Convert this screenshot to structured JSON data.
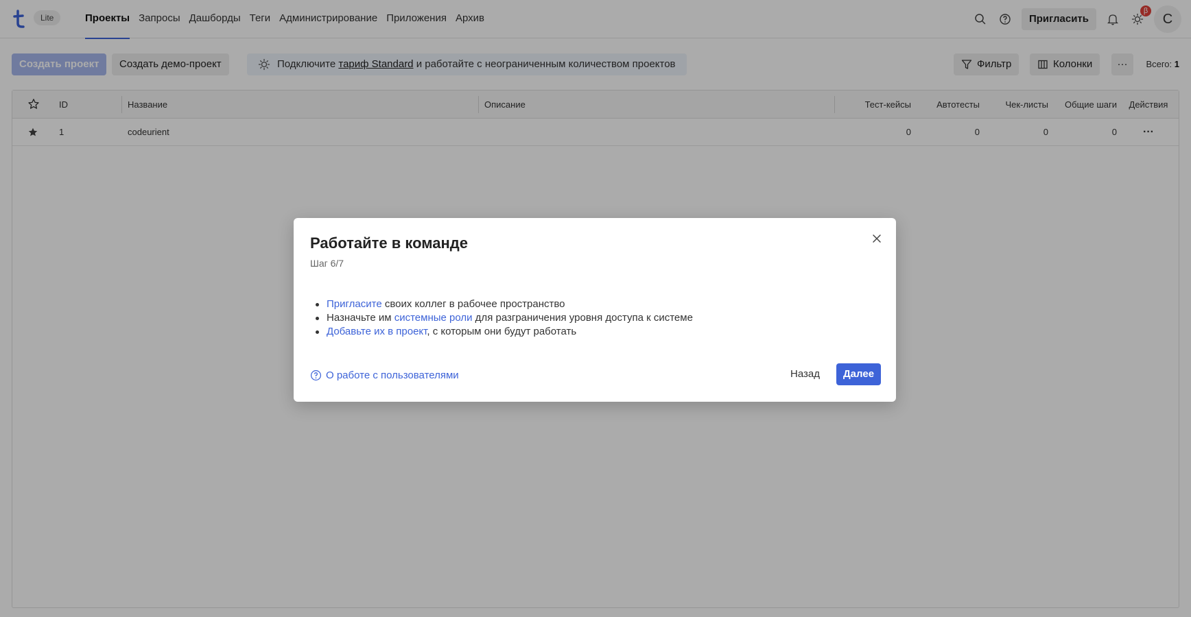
{
  "header": {
    "logo_icon": "tesys-logo",
    "plan_badge": "Lite",
    "nav": [
      {
        "label": "Проекты",
        "active": true
      },
      {
        "label": "Запросы"
      },
      {
        "label": "Дашборды"
      },
      {
        "label": "Теги"
      },
      {
        "label": "Администрирование"
      },
      {
        "label": "Приложения"
      },
      {
        "label": "Архив"
      }
    ],
    "invite_label": "Пригласить",
    "beta_badge": "β",
    "avatar_letter": "C",
    "accent_color": "#3d63d8"
  },
  "toolbar": {
    "create_label": "Создать проект",
    "demo_label": "Создать демо-проект",
    "promo_prefix": "Подключите",
    "promo_link": "тариф Standard",
    "promo_suffix": "и работайте с неограниченным количеством проектов",
    "filter_label": "Фильтр",
    "columns_label": "Колонки",
    "more_label": "···",
    "total_label": "Всего:",
    "total_value": "1"
  },
  "table": {
    "columns": [
      "ID",
      "Название",
      "Описание",
      "Тест-кейсы",
      "Автотесты",
      "Чек-листы",
      "Общие шаги",
      "Действия"
    ],
    "rows": [
      {
        "id": "1",
        "name": "codeurient",
        "description": "",
        "test_cases": "0",
        "autotests": "0",
        "checklists": "0",
        "shared_steps": "0",
        "actions": "···",
        "favorite": true
      }
    ]
  },
  "modal": {
    "title": "Работайте в команде",
    "step": "Шаг 6/7",
    "items": [
      {
        "link": "Пригласите",
        "text": " своих коллег в рабочее пространство",
        "pre": ""
      },
      {
        "pre": "Назначьте им ",
        "link": "системные роли",
        "text": " для разграничения уровня доступа к системе"
      },
      {
        "link": "Добавьте их в проект",
        "text": ", с которым они будут работать",
        "pre": ""
      }
    ],
    "help_link": "О работе с пользователями",
    "back_label": "Назад",
    "next_label": "Далее"
  }
}
